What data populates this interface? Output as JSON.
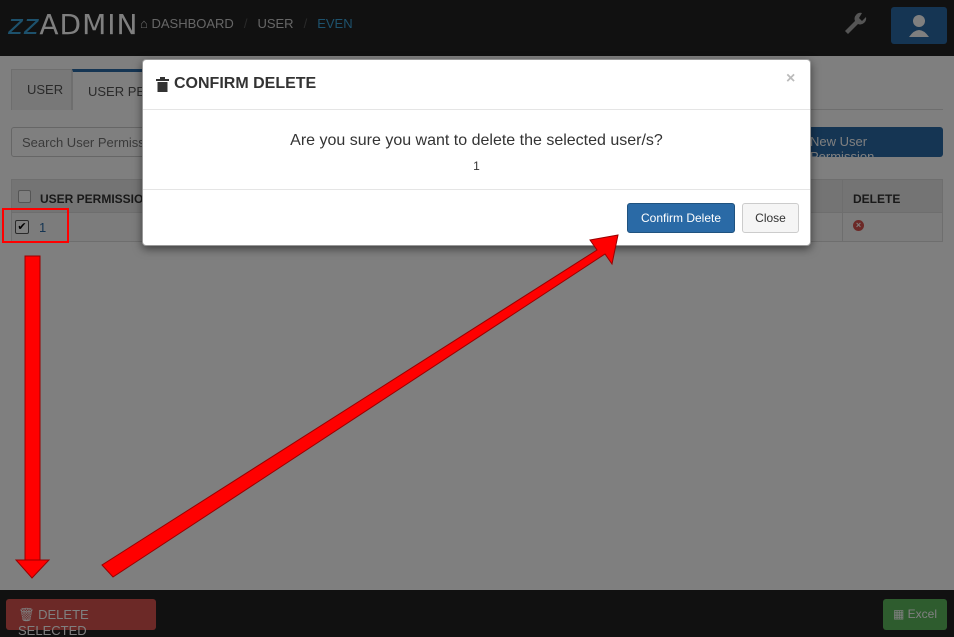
{
  "app": {
    "logo_prefix": "zz",
    "logo_text": "ADMIN"
  },
  "breadcrumb": {
    "home": "DASHBOARD",
    "level1": "USER",
    "level2": "EVEN"
  },
  "tabs": [
    {
      "label": "USER"
    },
    {
      "label": "USER PER"
    }
  ],
  "search": {
    "placeholder": "Search User Permiss"
  },
  "toolbar": {
    "new_label": "New User Permission"
  },
  "table": {
    "headers": {
      "permission": "USER PERMISSION",
      "delete": "DELETE"
    },
    "rows": [
      {
        "id": "1",
        "checked": true
      }
    ]
  },
  "footer": {
    "delete_selected": "DELETE SELECTED",
    "excel": "Excel"
  },
  "modal": {
    "title": "CONFIRM DELETE",
    "close_symbol": "×",
    "message": "Are you sure you want to delete the selected user/s?",
    "ids": "1",
    "confirm_label": "Confirm Delete",
    "close_label": "Close"
  },
  "colors": {
    "primary": "#2a6aa6",
    "danger": "#d9534f",
    "success": "#5cb85c",
    "annotation": "#ff0000"
  }
}
